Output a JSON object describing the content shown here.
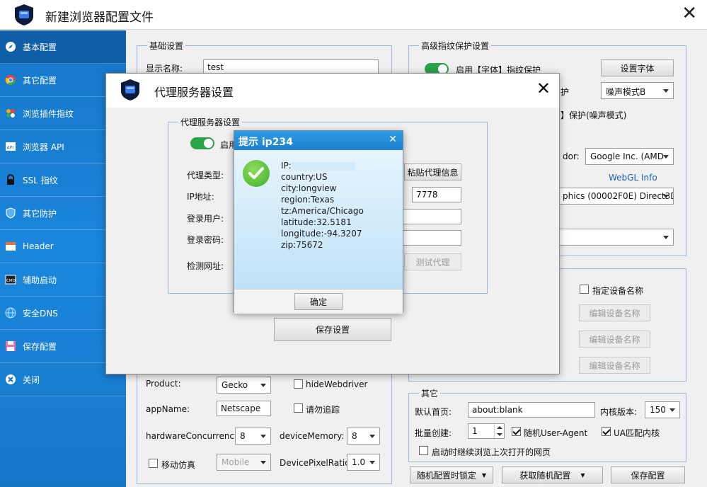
{
  "window": {
    "title": "新建浏览器配置文件"
  },
  "sidebar": {
    "items": [
      {
        "label": "基本配置",
        "icon": "compass-icon",
        "active": true
      },
      {
        "label": "其它配置",
        "icon": "chrome-icon"
      },
      {
        "label": "浏览插件指纹",
        "icon": "plugin-icon"
      },
      {
        "label": "浏览器 API",
        "icon": "api-icon"
      },
      {
        "label": "SSL 指纹",
        "icon": "lock-icon"
      },
      {
        "label": "其它防护",
        "icon": "shield-icon"
      },
      {
        "label": "Header",
        "icon": "header-icon"
      },
      {
        "label": "辅助启动",
        "icon": "cmd-icon"
      },
      {
        "label": "安全DNS",
        "icon": "globe-icon"
      },
      {
        "label": "保存配置",
        "icon": "save-icon"
      },
      {
        "label": "关闭",
        "icon": "close-circle-icon"
      }
    ]
  },
  "basic": {
    "legend": "基础设置",
    "display_name_label": "显示名称:",
    "display_name_value": "test",
    "product_label": "Product:",
    "product_value": "Gecko",
    "hide_webdriver": "hideWebdriver",
    "appname_label": "appName:",
    "appname_value": "Netscape",
    "no_track": "请勿追踪",
    "hw_label": "hardwareConcurrency:",
    "hw_value": "8",
    "devmem_label": "deviceMemory:",
    "devmem_value": "8",
    "mobile_label": "移动仿真",
    "mobile_select": "Mobile",
    "dpr_label": "DevicePixelRatio:",
    "dpr_value": "1.0"
  },
  "advanced": {
    "legend": "高级指纹保护设置",
    "font_protect": "启用【字体】指纹保护",
    "set_font_btn": "设置字体",
    "protect_suffix": "护",
    "noise_mode": "噪声模式B",
    "noise_label": "】保护(噪声模式)",
    "vendor_label": "dor:",
    "vendor_value": "Google Inc. (AMD",
    "webgl_info": "WebGL Info",
    "renderer_value": "phics (00002F0E) Direct3D1"
  },
  "device": {
    "specify_name": "指定设备名称",
    "edit_btn_1": "编辑设备名称",
    "edit_btn_2": "编辑设备名称",
    "edit_btn_3": "编辑设备名称"
  },
  "other": {
    "legend": "其它",
    "homepage_label": "默认首页:",
    "homepage_value": "about:blank",
    "kernel_label": "内核版本:",
    "kernel_value": "150",
    "batch_label": "批量创建:",
    "batch_value": "1",
    "random_ua": "随机User-Agent",
    "ua_match": "UA匹配内核",
    "continue_browse": "启动时继续浏览上次打开的网页"
  },
  "bottom": {
    "lock_btn": "随机配置时锁定",
    "random_btn": "获取随机配置",
    "save_btn": "保存配置"
  },
  "proxy": {
    "title": "代理服务器设置",
    "legend": "代理服务器设置",
    "enable_label": "启用",
    "type_label": "代理类型:",
    "paste_btn": "粘贴代理信息",
    "ip_label": "IP地址:",
    "port_value": "7778",
    "user_label": "登录用户:",
    "pass_label": "登录密码:",
    "check_label": "检测网址:",
    "test_btn": "测试代理",
    "save_btn": "保存设置"
  },
  "alert": {
    "title": "提示 ip234",
    "ip_prefix": "IP:",
    "country": "country:US",
    "city": "city:longview",
    "region": "region:Texas",
    "tz": "tz:America/Chicago",
    "latitude": "latitude:32.5181",
    "longitude": "longitude:-94.3207",
    "zip": "zip:75672",
    "ok_btn": "确定"
  },
  "colors": {
    "sidebar": "#1677c9",
    "toggle_on": "#2aa34a",
    "alert_title": "#1c7fd0",
    "link": "#1a5fb4"
  }
}
